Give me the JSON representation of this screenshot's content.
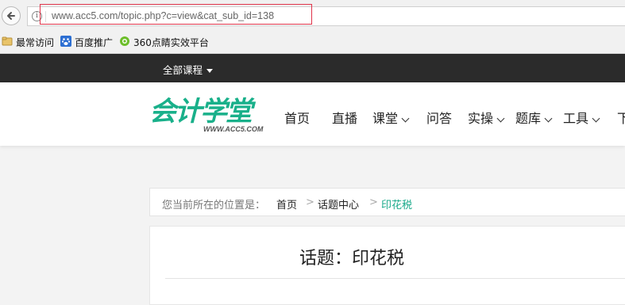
{
  "browser": {
    "url": "www.acc5.com/topic.php?c=view&cat_sub_id=138",
    "info_glyph": "i",
    "highlight_color": "#e0344a",
    "bookmarks": [
      {
        "label": "最常访问",
        "icon": "folder-icon"
      },
      {
        "label": "百度推广",
        "icon": "baidu-paw-icon"
      },
      {
        "label": "360点睛实效平台",
        "icon": "leaf-icon"
      }
    ]
  },
  "topbar": {
    "all_courses_label": "全部课程"
  },
  "header": {
    "logo_text": "会计学堂",
    "logo_url_text": "WWW.ACC5.COM",
    "brand_color": "#19b08a",
    "nav": [
      {
        "label": "首页",
        "has_dropdown": false
      },
      {
        "label": "直播",
        "has_dropdown": false
      },
      {
        "label": "课堂",
        "has_dropdown": true
      },
      {
        "label": "问答",
        "has_dropdown": false
      },
      {
        "label": "实操",
        "has_dropdown": true
      },
      {
        "label": "题库",
        "has_dropdown": true
      },
      {
        "label": "工具",
        "has_dropdown": true
      },
      {
        "label": "下",
        "has_dropdown": false
      }
    ]
  },
  "breadcrumb": {
    "prefix": "您当前所在的位置是：",
    "separator": ">",
    "items": [
      "首页",
      "话题中心"
    ],
    "current": "印花税",
    "current_color": "#19a98a"
  },
  "page": {
    "title": "话题：印花税"
  }
}
